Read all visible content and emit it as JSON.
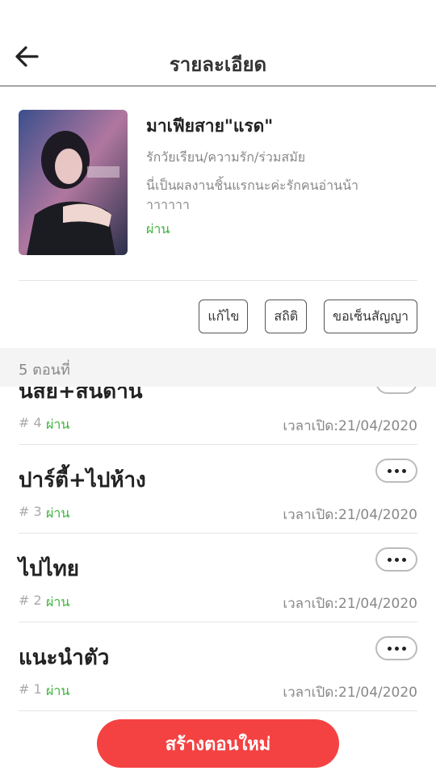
{
  "header": {
    "title": "รายละเอียด",
    "back_icon": "arrow-left-icon"
  },
  "book": {
    "title": "มาเฟียสาย\"แรด\"",
    "tags": "รักวัยเรียน/ความรัก/ร่วมสมัย",
    "description": "นี่เป็นผลงานชิ้นแรกนะค่ะรักคนอ่านน้าาาาาาา",
    "status": "ผ่าน"
  },
  "actions": {
    "edit": "แก้ไข",
    "stats": "สถิติ",
    "contract": "ขอเซ็นสัญญา"
  },
  "episode_count": "5 ตอนที่",
  "episodes": [
    {
      "title": "นิสัย+สันดาน",
      "number": "# 4",
      "status": "ผ่าน",
      "time": "เวลาเปิด:21/04/2020"
    },
    {
      "title": "ปาร์ตี้+ไปห้าง",
      "number": "# 3",
      "status": "ผ่าน",
      "time": "เวลาเปิด:21/04/2020"
    },
    {
      "title": "ไปไทย",
      "number": "# 2",
      "status": "ผ่าน",
      "time": "เวลาเปิด:21/04/2020"
    },
    {
      "title": "แนะนำตัว",
      "number": "# 1",
      "status": "ผ่าน",
      "time": "เวลาเปิด:21/04/2020"
    }
  ],
  "create_button": "สร้างตอนใหม่",
  "colors": {
    "accent": "#f44242",
    "pass": "#3cb43c"
  }
}
